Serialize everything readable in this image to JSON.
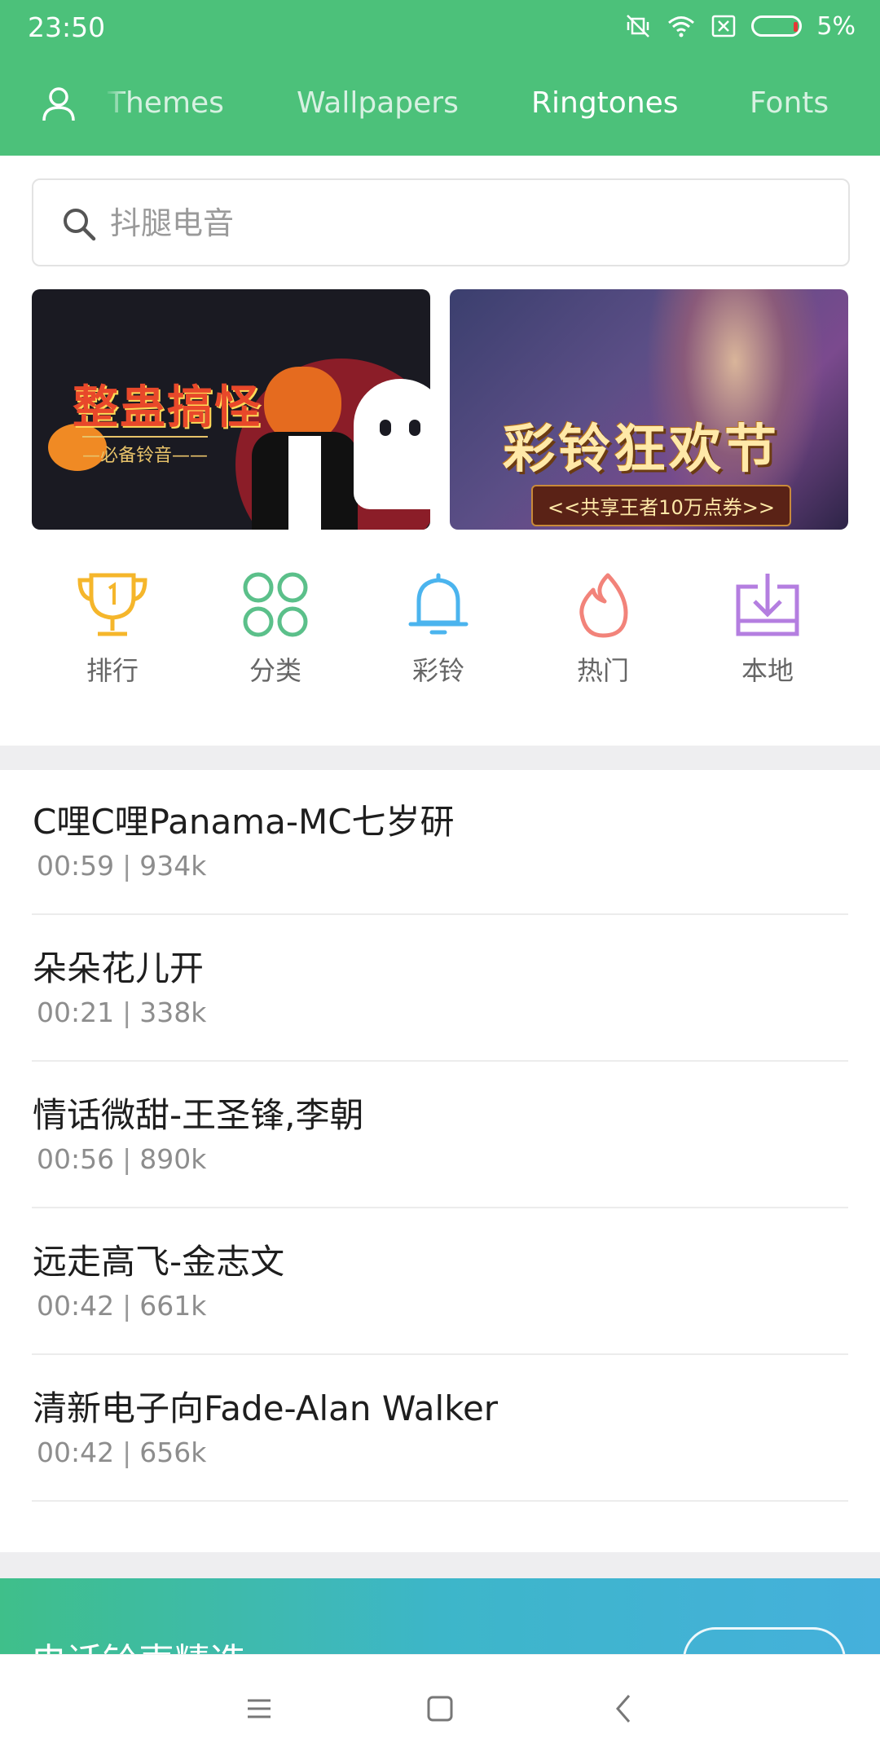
{
  "status_bar": {
    "time": "23:50",
    "battery_percent": "5%"
  },
  "header": {
    "tabs": [
      {
        "label": "Themes",
        "active": false
      },
      {
        "label": "Wallpapers",
        "active": false
      },
      {
        "label": "Ringtones",
        "active": true
      },
      {
        "label": "Fonts",
        "active": false
      }
    ]
  },
  "search": {
    "placeholder": "抖腿电音"
  },
  "banners": [
    {
      "title": "整蛊搞怪",
      "subtitle": "—必备铃音——"
    },
    {
      "title": "彩铃狂欢节",
      "subtitle": "<<共享王者10万点券>>"
    }
  ],
  "quick_links": [
    {
      "label": "排行",
      "icon": "trophy-icon",
      "color": "#F5B62B"
    },
    {
      "label": "分类",
      "icon": "grid-circles-icon",
      "color": "#5BC08A"
    },
    {
      "label": "彩铃",
      "icon": "bell-icon",
      "color": "#4BB4EE"
    },
    {
      "label": "热门",
      "icon": "flame-icon",
      "color": "#F2837A"
    },
    {
      "label": "本地",
      "icon": "download-icon",
      "color": "#B47EE0"
    }
  ],
  "songs": [
    {
      "title": "C哩C哩Panama-MC七岁研",
      "duration": "00:59",
      "size": "934k"
    },
    {
      "title": "朵朵花儿开",
      "duration": "00:21",
      "size": "338k"
    },
    {
      "title": "情话微甜-王圣锋,李朝",
      "duration": "00:56",
      "size": "890k"
    },
    {
      "title": "远走高飞-金志文",
      "duration": "00:42",
      "size": "661k"
    },
    {
      "title": "清新电子向Fade-Alan Walker",
      "duration": "00:42",
      "size": "656k"
    }
  ],
  "promo": {
    "title": "电话铃声精选"
  },
  "colors": {
    "header": "#4CC17A"
  }
}
